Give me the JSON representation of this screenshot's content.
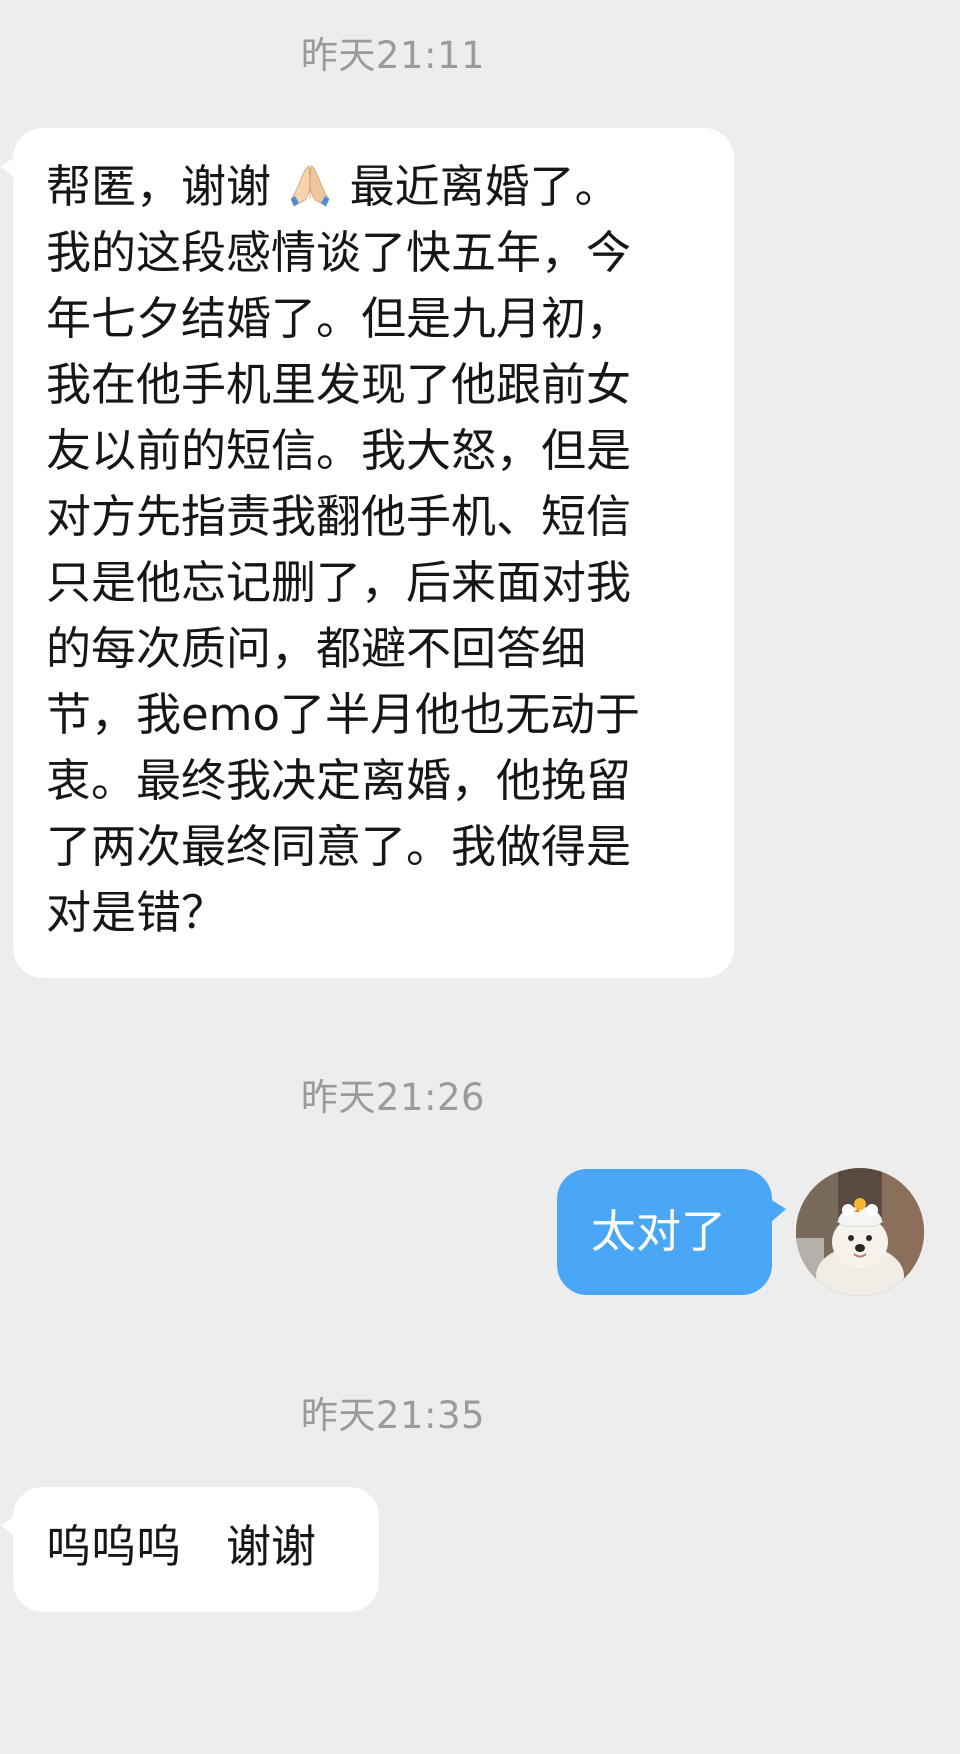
{
  "chat": {
    "timestamps": [
      "昨天21:11",
      "昨天21:26",
      "昨天21:35"
    ],
    "messages": [
      {
        "side": "left",
        "lines": [
          "帮匿，谢谢",
          "最近离婚了。",
          "我的这段感情谈了快五年，今",
          "年七夕结婚了。但是九月初，",
          "我在他手机里发现了他跟前女",
          "友以前的短信。我大怒，但是",
          "对方先指责我翻他手机、短信",
          "只是他忘记删了，后来面对我",
          "的每次质问，都避不回答细",
          "节，我emo了半月他也无动于",
          "衷。最终我决定离婚，他挽留",
          "了两次最终同意了。我做得是",
          "对是错？"
        ],
        "inline_emoji": "folded-hands-icon"
      },
      {
        "side": "right",
        "text": "太对了"
      },
      {
        "side": "left",
        "text": "呜呜呜　谢谢"
      }
    ]
  },
  "colors": {
    "background": "#ededed",
    "incoming_bubble": "#ffffff",
    "outgoing_bubble": "#4aa7f6",
    "timestamp": "#9b9b9b"
  },
  "avatar": {
    "icon": "dog-avatar-icon"
  }
}
